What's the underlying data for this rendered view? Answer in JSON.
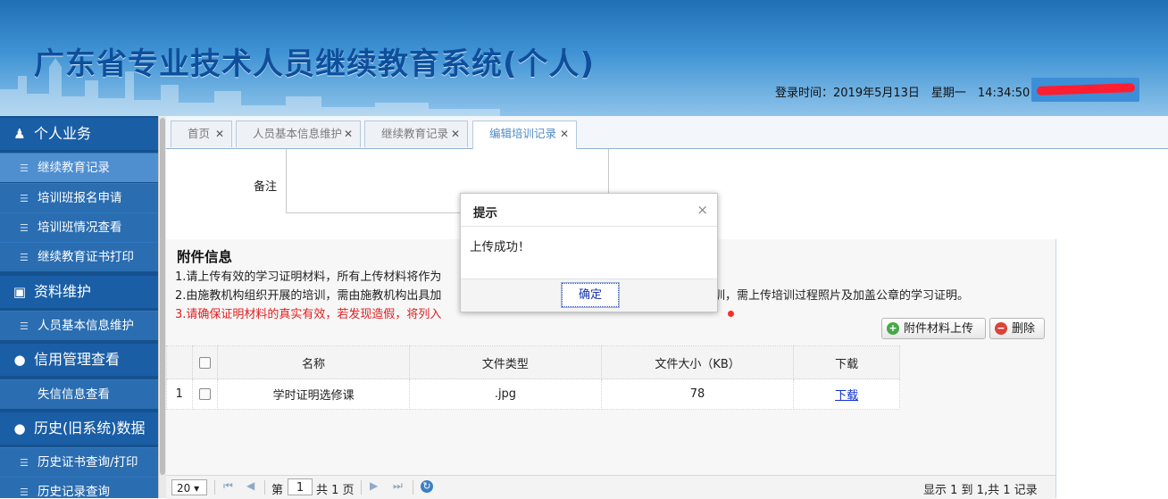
{
  "header": {
    "title": "广东省专业技术人员继续教育系统(个人)",
    "login_info": "登录时间：2019年5月13日　星期一　14:34:50"
  },
  "sidebar": {
    "groups": [
      {
        "label": "个人业务",
        "icon": "user-icon"
      },
      {
        "label": "资料维护",
        "icon": "book-icon"
      },
      {
        "label": "信用管理查看",
        "icon": "bulb-icon"
      },
      {
        "label": "历史(旧系统)数据",
        "icon": "bulb-icon"
      }
    ],
    "items": [
      {
        "label": "继续教育记录",
        "active": true
      },
      {
        "label": "培训班报名申请"
      },
      {
        "label": "培训班情况查看"
      },
      {
        "label": "继续教育证书打印"
      },
      {
        "label": "人员基本信息维护"
      },
      {
        "label": "失信信息查看"
      },
      {
        "label": "历史证书查询/打印"
      },
      {
        "label": "历史记录查询"
      }
    ]
  },
  "tabs": [
    {
      "label": "首页"
    },
    {
      "label": "人员基本信息维护"
    },
    {
      "label": "继续教育记录"
    },
    {
      "label": "编辑培训记录",
      "active": true
    }
  ],
  "form": {
    "remark_label": "备注"
  },
  "attachments": {
    "title": "附件信息",
    "notes": [
      "1.请上传有效的学习证明材料，所有上传材料将作为",
      "2.由施教机构组织开展的培训，需由施教机构出具加",
      "3.请确保证明材料的真实有效，若发现造假，将列入"
    ],
    "note2_tail": "训，需上传培训过程照片及加盖公章的学习证明。",
    "upload_button": "附件材料上传",
    "delete_button": "删除",
    "columns": [
      "名称",
      "文件类型",
      "文件大小（KB）",
      "下载"
    ],
    "rows": [
      {
        "index": "1",
        "name": "学时证明选修课",
        "type": ".jpg",
        "size": "78",
        "download": "下载"
      }
    ]
  },
  "pager": {
    "page_size": "20",
    "page_label_pre": "第",
    "page_number": "1",
    "page_label_post": "共 1 页",
    "info": "显示 1 到 1,共 1 记录"
  },
  "dialog": {
    "title": "提示",
    "message": "上传成功！",
    "ok_label": "确定"
  },
  "colors": {
    "sidebar_bg": "#16518f",
    "active_tab_text": "#4f8bc4",
    "warning_text": "#e02020"
  }
}
